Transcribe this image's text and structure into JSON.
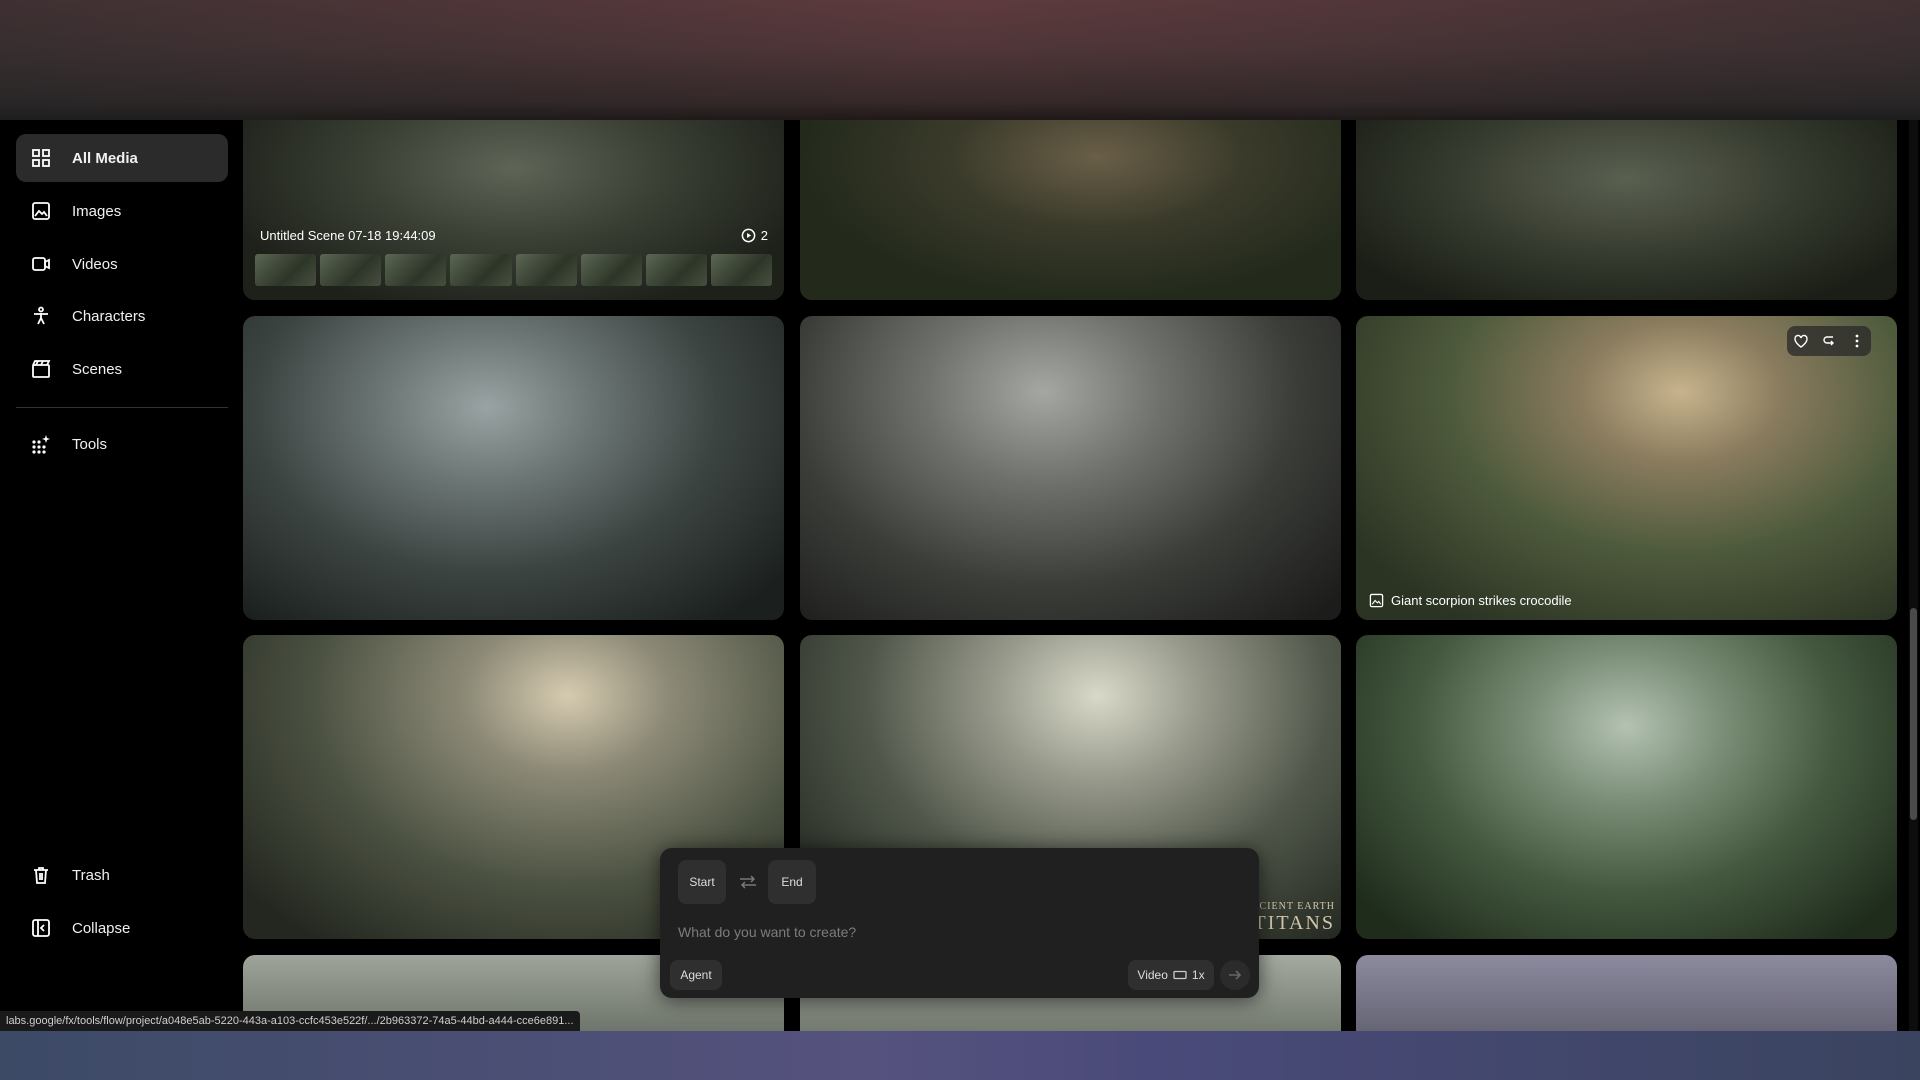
{
  "sidebar": {
    "items": [
      {
        "label": "All Media",
        "icon": "grid-icon"
      },
      {
        "label": "Images",
        "icon": "image-icon"
      },
      {
        "label": "Videos",
        "icon": "video-icon"
      },
      {
        "label": "Characters",
        "icon": "person-icon"
      },
      {
        "label": "Scenes",
        "icon": "clapperboard-icon"
      },
      {
        "label": "Tools",
        "icon": "sparkle-grid-icon"
      }
    ],
    "footer": [
      {
        "label": "Trash",
        "icon": "trash-icon"
      },
      {
        "label": "Collapse",
        "icon": "collapse-icon"
      }
    ]
  },
  "grid": {
    "scene_card": {
      "title": "Untitled Scene 07-18 19:44:09",
      "count": "2"
    },
    "hover_caption": "Giant scorpion strikes crocodile",
    "watermark_top": "ANCIENT EARTH",
    "watermark_bottom": "TITANS"
  },
  "composer": {
    "start_label": "Start",
    "end_label": "End",
    "placeholder": "What do you want to create?",
    "agent_label": "Agent",
    "mode_label": "Video",
    "multiplier": "1x"
  },
  "status_url": "labs.google/fx/tools/flow/project/a048e5ab-5220-443a-a103-ccfc453e522f/.../2b963372-74a5-44bd-a444-cce6e891...",
  "colors": {
    "accent_bg": "#2b2b2b",
    "page_bg": "#000000"
  }
}
